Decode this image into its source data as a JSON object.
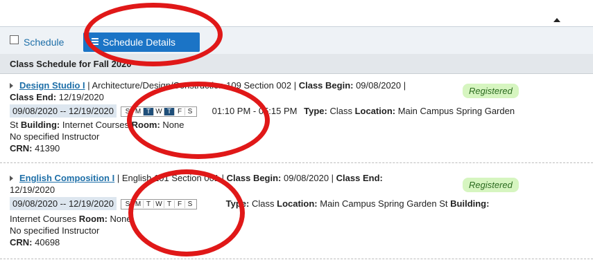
{
  "tabs": {
    "schedule": "Schedule",
    "details": "Schedule Details"
  },
  "section_title": "Class Schedule for Fall 2020",
  "courses": [
    {
      "title": "Design Studio I",
      "header_rest": " | Architecture/Design/Construction 109 Section 002 | ",
      "begin_label": "Class Begin:",
      "begin": " 09/08/2020 |",
      "end_label": "Class End:",
      "end": " 12/19/2020",
      "status": "Registered",
      "date_range": "09/08/2020 -- 12/19/2020",
      "days": [
        "S",
        "M",
        "T",
        "W",
        "T",
        "F",
        "S"
      ],
      "time": "01:10 PM - 05:15 PM",
      "type_label": "Type:",
      "type": "Class",
      "location_label": "Location:",
      "location": "Main Campus Spring Garden",
      "location_cont": "St",
      "building_label": "Building:",
      "building": "Internet Courses",
      "room_label": "Room:",
      "room": "None",
      "instructor": "No specified Instructor",
      "crn_label": "CRN:",
      "crn": "41390"
    },
    {
      "title": "English Composition I",
      "header_rest": " | English 101 Section 001 | ",
      "begin_label": "Class Begin:",
      "begin": " 09/08/2020 | ",
      "end_label": "Class End:",
      "end": "12/19/2020",
      "status": "Registered",
      "date_range": "09/08/2020 -- 12/19/2020",
      "days": [
        "S",
        "M",
        "T",
        "W",
        "T",
        "F",
        "S"
      ],
      "type_label": "Type:",
      "type": "Class",
      "location_label": "Location:",
      "location": "Main Campus Spring Garden St",
      "building_label": "Building:",
      "building": "Internet Courses",
      "room_label": "Room:",
      "room": "None",
      "instructor": "No specified Instructor",
      "crn_label": "CRN:",
      "crn": "40698"
    }
  ],
  "colors": {
    "accent": "#1b74c6",
    "link": "#1e6fa8",
    "highlight_circle": "#e01818",
    "badge_bg": "#d6f5c0"
  }
}
